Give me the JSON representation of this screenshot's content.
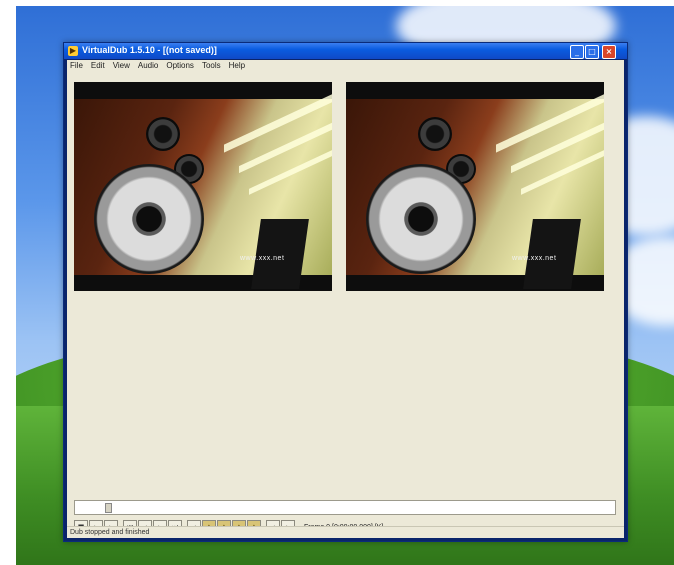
{
  "window": {
    "title": "VirtualDub 1.5.10 - [(not saved)]",
    "app_icon": "virtualdub-icon"
  },
  "menu": [
    "File",
    "Edit",
    "View",
    "Audio",
    "Options",
    "Tools",
    "Help"
  ],
  "video_panes": {
    "input_watermark": "www.xxx.net",
    "output_watermark": "www.xxx.net"
  },
  "position": {
    "frame_info": "Frame 0 [0:00:00.000] [K]"
  },
  "toolbar": {
    "buttons": [
      "stop",
      "play-input",
      "play-output",
      "start",
      "back",
      "forward",
      "end",
      "prev-key",
      "next-key",
      "scene-back",
      "scene-fwd",
      "mark-in",
      "mark-out"
    ]
  },
  "status": {
    "text": "Dub stopped and finished"
  },
  "colors": {
    "titlebar": "#0a5ce0",
    "client_bg": "#ece9d8",
    "close_button": "#d9462a"
  }
}
